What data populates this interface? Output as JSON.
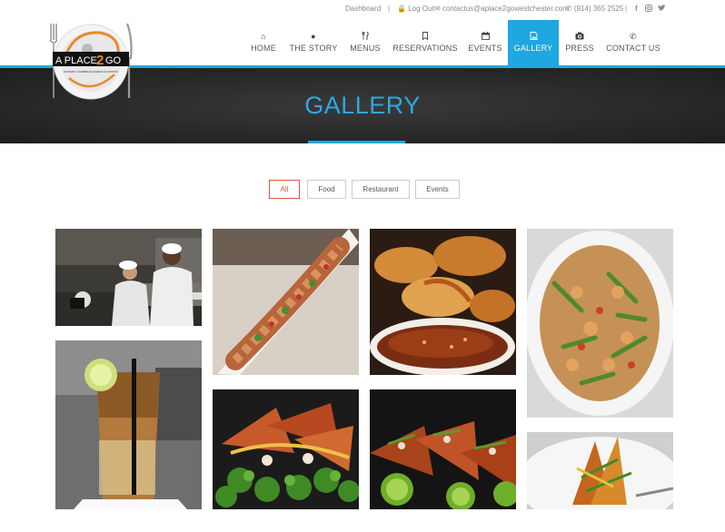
{
  "topbar": {
    "dashboard": "Dashboard",
    "sep1": "|",
    "logout": "Log Out",
    "email": "contactus@aplace2gowestchester.com",
    "phone": "(914) 365 2525",
    "sep2": "|"
  },
  "logo": {
    "text_line1": "A PLACE",
    "text_num": "2",
    "text_line2": "GO",
    "tagline": "MODERN CARIBBEAN AMERICAN BISTRO"
  },
  "nav": [
    {
      "label": "HOME",
      "icon": "home-icon"
    },
    {
      "label": "THE STORY",
      "icon": "circle-icon"
    },
    {
      "label": "MENUS",
      "icon": "cutlery-icon"
    },
    {
      "label": "RESERVATIONS",
      "icon": "bookmark-icon"
    },
    {
      "label": "EVENTS",
      "icon": "calendar-icon"
    },
    {
      "label": "GALLERY",
      "icon": "image-icon",
      "active": true
    },
    {
      "label": "PRESS",
      "icon": "camera-icon"
    },
    {
      "label": "CONTACT US",
      "icon": "phone-icon"
    }
  ],
  "hero": {
    "title": "GALLERY"
  },
  "filters": [
    {
      "label": "All",
      "active": true
    },
    {
      "label": "Food"
    },
    {
      "label": "Restaurant"
    },
    {
      "label": "Events"
    }
  ],
  "colors": {
    "accent": "#1ea7e1",
    "filter_active": "#e8533b",
    "hero_bg": "#2a2a2a"
  },
  "gallery": [
    {
      "subject": "chefs-in-kitchen-photo"
    },
    {
      "subject": "shrimp-platter-photo"
    },
    {
      "subject": "fried-shrimp-sauce-photo"
    },
    {
      "subject": "pasta-salad-photo"
    },
    {
      "subject": "iced-tea-drink-photo"
    },
    {
      "subject": "crispy-wontons-photo"
    },
    {
      "subject": "tacos-with-lime-photo"
    },
    {
      "subject": "plated-dish-photo"
    }
  ]
}
